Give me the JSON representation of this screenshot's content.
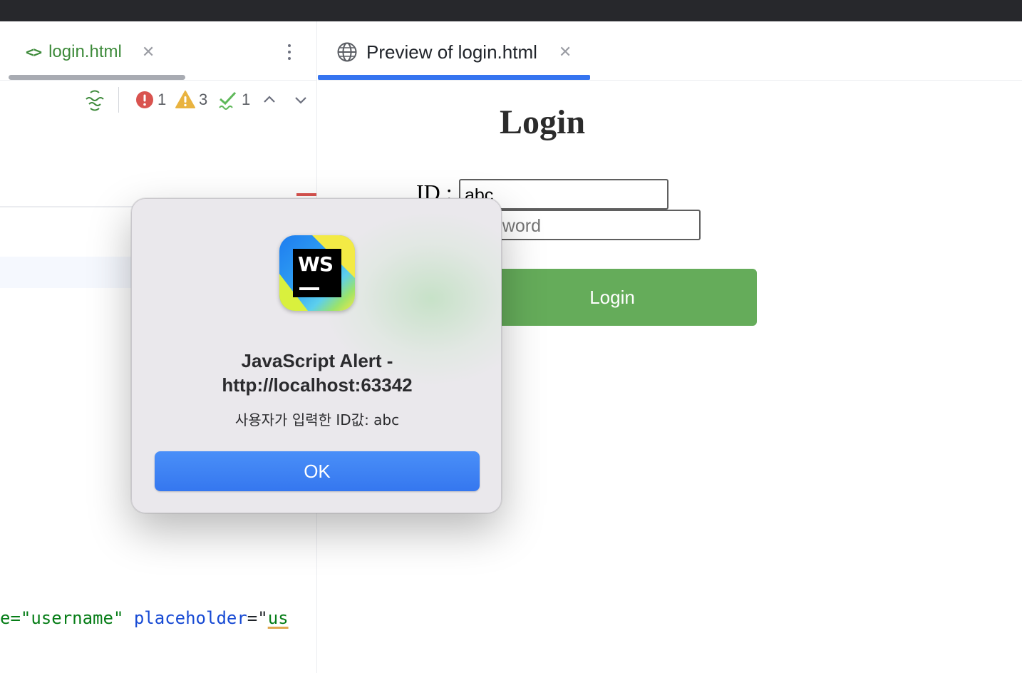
{
  "editor": {
    "tab_label": "login.html",
    "tab_icon": "code-icon",
    "inspections": {
      "errors": "1",
      "warnings": "3",
      "weak_warnings": "1"
    },
    "code_line": {
      "part1": "e=\"username\"",
      "part2": "placeholder",
      "part3": "=\"",
      "part4": "us"
    }
  },
  "preview": {
    "tab_label": "Preview of login.html",
    "tab_icon": "globe-icon",
    "page_title": "Login",
    "id_label": "ID :",
    "id_value": "abc",
    "password_placeholder": "password",
    "login_button": "Login"
  },
  "dialog": {
    "title": "JavaScript Alert - http://localhost:63342",
    "message": "사용자가 입력한 ID값: abc",
    "ok_button": "OK",
    "app_icon_text": "WS"
  },
  "colors": {
    "accent": "#3574f0",
    "login_green": "#65ac5a",
    "error_red": "#d9534f",
    "warning_yellow": "#e9b340",
    "ok_check_green": "#5fb85a"
  }
}
